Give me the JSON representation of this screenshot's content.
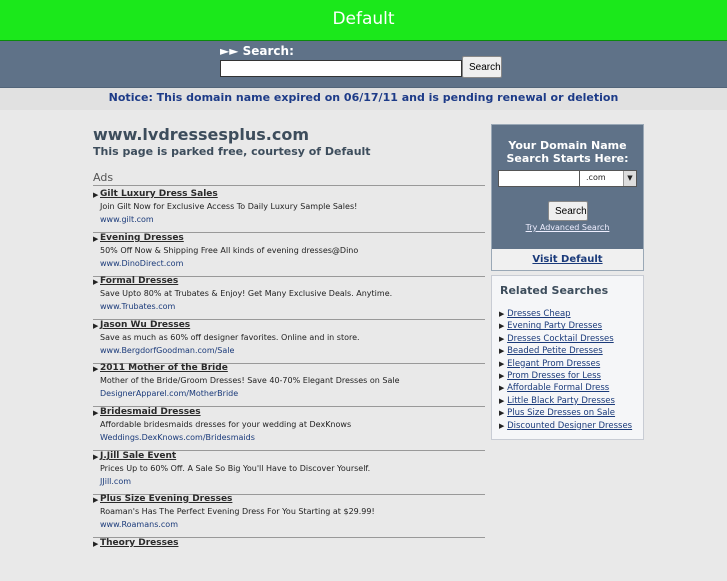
{
  "header": {
    "title": "Default"
  },
  "search": {
    "label": "►► Search:",
    "input_value": "",
    "button_label": "Search"
  },
  "notice": {
    "text": "Notice: This domain name expired on 06/17/11 and is pending renewal or deletion"
  },
  "main": {
    "domain": "www.lvdressesplus.com",
    "parked": "This page is parked free, courtesy of Default",
    "ads_heading": "Ads"
  },
  "ads": [
    {
      "title": "Gilt Luxury Dress Sales",
      "desc": "Join Gilt Now for Exclusive Access To Daily Luxury Sample Sales!",
      "url": "www.gilt.com"
    },
    {
      "title": "Evening Dresses",
      "desc": "50% Off Now & Shipping Free All kinds of evening dresses@Dino",
      "url": "www.DinoDirect.com"
    },
    {
      "title": "Formal Dresses",
      "desc": "Save Upto 80% at Trubates & Enjoy! Get Many Exclusive Deals. Anytime.",
      "url": "www.Trubates.com"
    },
    {
      "title": "Jason Wu Dresses",
      "desc": "Save as much as 60% off designer favorites. Online and in store.",
      "url": "www.BergdorfGoodman.com/Sale"
    },
    {
      "title": "2011 Mother of the Bride",
      "desc": "Mother of the Bride/Groom Dresses! Save 40-70% Elegant Dresses on Sale",
      "url": "DesignerApparel.com/MotherBride"
    },
    {
      "title": "Bridesmaid Dresses",
      "desc": "Affordable bridesmaids dresses for your wedding at DexKnows",
      "url": "Weddings.DexKnows.com/Bridesmaids"
    },
    {
      "title": "J.Jill Sale Event",
      "desc": "Prices Up to 60% Off. A Sale So Big You'll Have to Discover Yourself.",
      "url": "JJill.com"
    },
    {
      "title": "Plus Size Evening Dresses",
      "desc": "Roaman's Has The Perfect Evening Dress For You Starting at $29.99!",
      "url": "www.Roamans.com"
    },
    {
      "title": "Theory Dresses",
      "desc": "",
      "url": ""
    }
  ],
  "domain_search": {
    "heading_line1": "Your Domain Name",
    "heading_line2": "Search Starts Here:",
    "input_value": "",
    "tld": ".com",
    "button_label": "Search",
    "advanced_link": "Try Advanced Search",
    "visit_link": "Visit Default"
  },
  "related": {
    "heading": "Related Searches",
    "items": [
      "Dresses Cheap",
      "Evening Party Dresses",
      "Dresses Cocktail Dresses",
      "Beaded Petite Dresses",
      "Elegant Prom Dresses",
      "Prom Dresses for Less",
      "Affordable Formal Dress",
      "Little Black Party Dresses",
      "Plus Size Dresses on Sale",
      "Discounted Designer Dresses"
    ]
  }
}
